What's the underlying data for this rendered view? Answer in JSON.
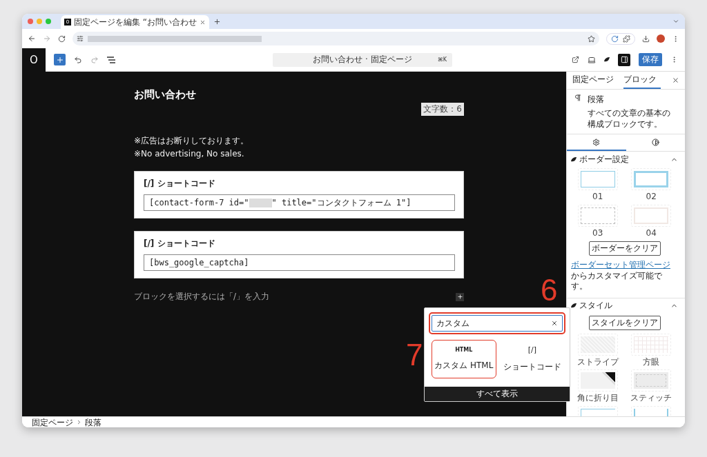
{
  "browser": {
    "tab_title": "固定ページを編集 “お問い合わせ",
    "tab_favicon": "0"
  },
  "toolbar": {
    "logo": "O",
    "command_title": "お問い合わせ · 固定ページ",
    "shortcut": "⌘K",
    "save": "保存",
    "sidebar_open": true
  },
  "editor": {
    "title": "お問い合わせ",
    "char_count": "文字数：6",
    "paragraphs": [
      "※広告はお断りしております。",
      "※No advertising, No sales."
    ],
    "blocks": [
      {
        "label": "[/] ショートコード",
        "segments": [
          {
            "kind": "text",
            "text": "[contact-form-7 id=\""
          },
          {
            "kind": "redacted"
          },
          {
            "kind": "text",
            "text": "\" title=\"コンタクトフォーム 1\"]"
          }
        ]
      },
      {
        "label": "[/] ショートコード",
        "segments": [
          {
            "kind": "text",
            "text": "[bws_google_captcha]"
          }
        ]
      }
    ],
    "placeholder": "ブロックを選択するには「/」を入力"
  },
  "inserter": {
    "search_value": "カスタム",
    "search_highlighted": true,
    "search_annotation": "6",
    "results": [
      {
        "icon_text": "HTML",
        "label": "カスタム HTML",
        "highlighted": true,
        "annotation": "7"
      },
      {
        "icon_text": "[/]",
        "label": "ショートコード",
        "highlighted": false
      }
    ],
    "footer": "すべて表示"
  },
  "sidebar": {
    "tabs": [
      {
        "label": "固定ページ",
        "selected": false
      },
      {
        "label": "ブロック",
        "selected": true
      }
    ],
    "block": {
      "name": "段落",
      "description": "すべての文章の基本の構成ブロックです。"
    },
    "subtabs": [
      {
        "kind": "settings",
        "selected": true
      },
      {
        "kind": "styles",
        "selected": false
      }
    ],
    "panels": [
      {
        "kind": "border",
        "title": "ボーダー設定",
        "expanded": true,
        "clear_button": "ボーダーをクリア",
        "note_link": "ボーダーセット管理ページ",
        "note": "からカスタマイズ可能です。",
        "presets": [
          {
            "kind": "thin",
            "label": "01"
          },
          {
            "kind": "thick",
            "label": "02"
          },
          {
            "kind": "dashed",
            "label": "03"
          },
          {
            "kind": "faint",
            "label": "04"
          }
        ]
      },
      {
        "kind": "style",
        "title": "スタイル",
        "expanded": true,
        "clear_button": "スタイルをクリア",
        "presets": [
          {
            "kind": "stripe",
            "label": "ストライプ"
          },
          {
            "kind": "grid",
            "label": "方眼"
          },
          {
            "kind": "fold",
            "label": "角に折り目"
          },
          {
            "kind": "stitch",
            "label": "スティッチ"
          },
          {
            "kind": "corners"
          },
          {
            "kind": "brackets"
          }
        ]
      }
    ]
  },
  "status_bar": {
    "breadcrumbs": [
      "固定ページ",
      "段落"
    ]
  }
}
